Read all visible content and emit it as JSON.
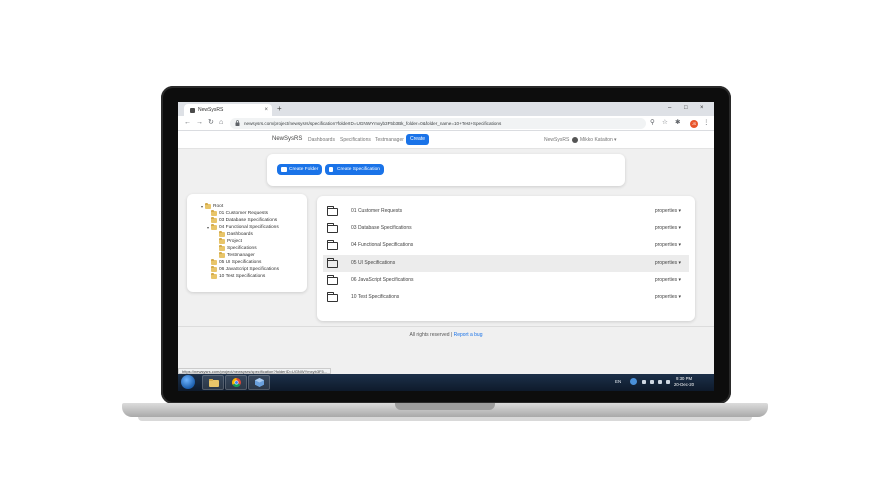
{
  "browser": {
    "tab_title": "NewSysRS",
    "url": "newsysrs.com/project/newsysrs/specification?folderID=UGNWYmxyb3F5b3Bk_folder=0&folder_name=10+Test+Specifications",
    "profile_initials": "JS",
    "status_url": "https://newsysrs.com/project/newsysrs/specification?folderID=UGNWYmxyb3F5..."
  },
  "nav": {
    "brand": "NewSysRS",
    "links": [
      "Dashboards",
      "Specifications",
      "Testmanager"
    ],
    "create_label": "Create",
    "project": "NewSysRS",
    "user": "Mikko Kataiton"
  },
  "actions": {
    "create_folder": "Create Folder",
    "create_specification": "Create Specification"
  },
  "tree": {
    "root": "Root",
    "items": [
      {
        "label": "01 Customer Requests",
        "level": 1
      },
      {
        "label": "03 Database Specifications",
        "level": 1
      },
      {
        "label": "04 Functional Specifications",
        "level": 1
      },
      {
        "label": "Dashboards",
        "level": 2
      },
      {
        "label": "Project",
        "level": 2
      },
      {
        "label": "Specifications",
        "level": 2
      },
      {
        "label": "Testmanager",
        "level": 2
      },
      {
        "label": "05 UI Specifications",
        "level": 1
      },
      {
        "label": "06 JavaScript Specifications",
        "level": 1
      },
      {
        "label": "10 Test Specifications",
        "level": 1
      }
    ]
  },
  "folders": [
    {
      "name": "01 Customer Requests",
      "action": "properties ▾"
    },
    {
      "name": "03 Database Specifications",
      "action": "properties ▾"
    },
    {
      "name": "04 Functional Specifications",
      "action": "properties ▾"
    },
    {
      "name": "05 UI Specifications",
      "action": "properties ▾"
    },
    {
      "name": "06 JavaScript Specifications",
      "action": "properties ▾"
    },
    {
      "name": "10 Test Specifications",
      "action": "properties ▾"
    }
  ],
  "footer": {
    "text": "All rights reserved |",
    "link": "Report a bug"
  },
  "taskbar": {
    "language": "EN",
    "time": "9:30 PM",
    "date": "20-Dec-20"
  },
  "colors": {
    "accent": "#1a73e8",
    "highlight_row": "#ececec"
  }
}
